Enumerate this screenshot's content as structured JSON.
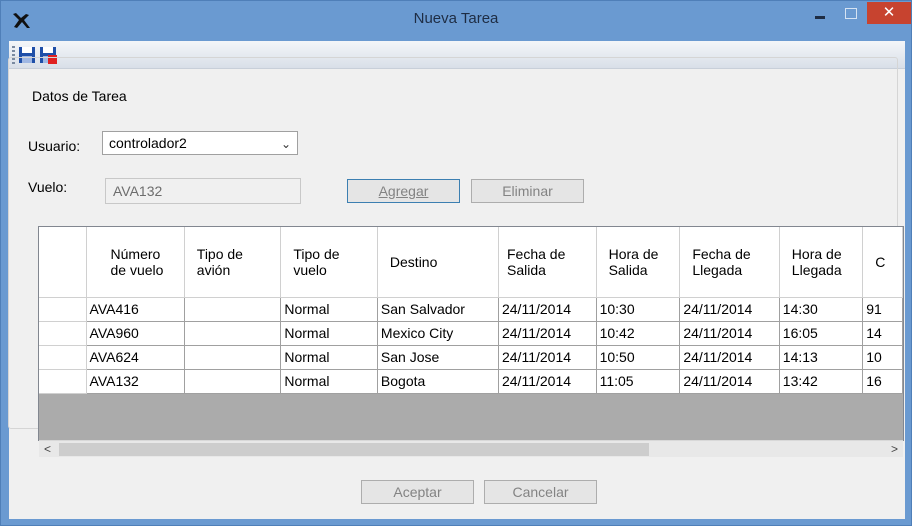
{
  "window": {
    "title": "Nueva Tarea",
    "close_glyph": "✕"
  },
  "form": {
    "group_title": "Datos de Tarea",
    "usuario_label": "Usuario:",
    "usuario_value": "controlador2",
    "vuelo_label": "Vuelo:",
    "vuelo_value": "AVA132",
    "agregar_label": "Agregar",
    "eliminar_label": "Eliminar",
    "aceptar_label": "Aceptar",
    "cancelar_label": "Cancelar"
  },
  "grid": {
    "headers": [
      "Número de vuelo",
      "Tipo de avión",
      "Tipo de vuelo",
      "Destino",
      "Fecha de Salida",
      "Hora de Salida",
      "Fecha de Llegada",
      "Hora de Llegada",
      "C"
    ],
    "rows": [
      [
        "AVA416",
        "",
        "Normal",
        "San Salvador",
        "24/11/2014",
        "10:30",
        "24/11/2014",
        "14:30",
        "91"
      ],
      [
        "AVA960",
        "",
        "Normal",
        "Mexico City",
        "24/11/2014",
        "10:42",
        "24/11/2014",
        "16:05",
        "14"
      ],
      [
        "AVA624",
        "",
        "Normal",
        "San Jose",
        "24/11/2014",
        "10:50",
        "24/11/2014",
        "14:13",
        "10"
      ],
      [
        "AVA132",
        "",
        "Normal",
        "Bogota",
        "24/11/2014",
        "11:05",
        "24/11/2014",
        "13:42",
        "16"
      ]
    ]
  },
  "scroll": {
    "left_glyph": "<",
    "right_glyph": ">"
  },
  "icons": {
    "app": "airplane-icon",
    "save": "save-icon",
    "save_close": "save-close-icon"
  },
  "colors": {
    "titlebar": "#6a9ad1",
    "close": "#c7432f",
    "grid_empty": "#ababab"
  }
}
